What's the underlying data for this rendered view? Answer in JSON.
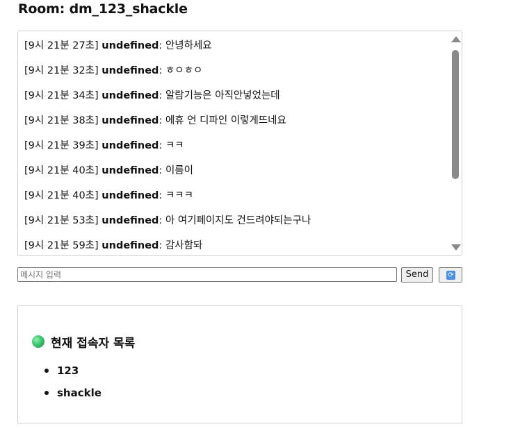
{
  "room": {
    "label": "Room: ",
    "name": "dm_123_shackle"
  },
  "messages": [
    {
      "time": "[9시 21분 27초]",
      "user": "undefined",
      "text": ": 안녕하세요"
    },
    {
      "time": "[9시 21분 32초]",
      "user": "undefined",
      "text": ": ㅎㅇㅎㅇ"
    },
    {
      "time": "[9시 21분 34초]",
      "user": "undefined",
      "text": ": 알람기능은 아직안넣었는데"
    },
    {
      "time": "[9시 21분 38초]",
      "user": "undefined",
      "text": ": 에휴 언 디파인 이렇게뜨네요"
    },
    {
      "time": "[9시 21분 39초]",
      "user": "undefined",
      "text": ": ㅋㅋ"
    },
    {
      "time": "[9시 21분 40초]",
      "user": "undefined",
      "text": ": 이름이"
    },
    {
      "time": "[9시 21분 40초]",
      "user": "undefined",
      "text": ": ㅋㅋㅋ"
    },
    {
      "time": "[9시 21분 53초]",
      "user": "undefined",
      "text": ": 아 여기페이지도 건드려야되는구나"
    },
    {
      "time": "[9시 21분 59초]",
      "user": "undefined",
      "text": ": 감사함돠"
    }
  ],
  "composer": {
    "placeholder": "메시지 입력",
    "value": "",
    "send_label": "Send",
    "refresh_icon": "refresh-icon",
    "refresh_glyph": "⟳"
  },
  "users": {
    "heading": "현재 접속자 목록",
    "status_icon": "online-dot-icon",
    "status_color": "#3cc56f",
    "list": [
      "123",
      "shackle"
    ]
  }
}
